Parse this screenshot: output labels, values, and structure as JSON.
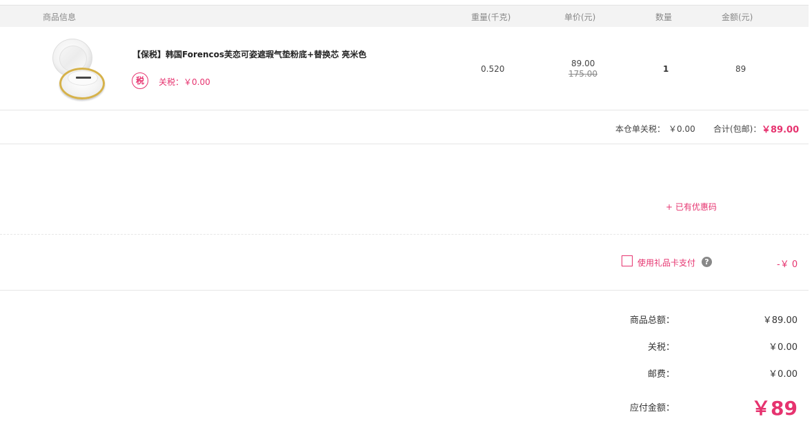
{
  "table_header": {
    "info": "商品信息",
    "weight": "重量(千克)",
    "unit_price": "单价(元)",
    "quantity": "数量",
    "amount": "金额(元)"
  },
  "item": {
    "title": "【保税】韩国Forencos芙恋可姿遮瑕气垫粉底+替换芯 亮米色",
    "tax_badge": "税",
    "tax_line": "关税：￥0.00",
    "weight": "0.520",
    "price_now": "89.00",
    "price_old": "175.00",
    "quantity": "1",
    "amount": "89",
    "image_icon": "cushion-compact-image"
  },
  "subtotal": {
    "duty_label": "本仓单关税：",
    "duty_value": "￥0.00",
    "total_label": "合计(包邮)：",
    "total_value": "￥89.00"
  },
  "coupon": {
    "link_text": "+ 已有优惠码"
  },
  "gift_card": {
    "label": "使用礼品卡支付",
    "help_icon": "?",
    "amount": "-￥ 0"
  },
  "summary": {
    "goods_label": "商品总额：",
    "goods_value": "￥89.00",
    "duty_label": "关税：",
    "duty_value": "￥0.00",
    "shipping_label": "邮费：",
    "shipping_value": "￥0.00",
    "payable_label": "应付金额：",
    "payable_value": "￥89"
  },
  "colors": {
    "accent": "#e6336f",
    "header_bg": "#f3f3f3",
    "divider": "#e5e5e5"
  }
}
